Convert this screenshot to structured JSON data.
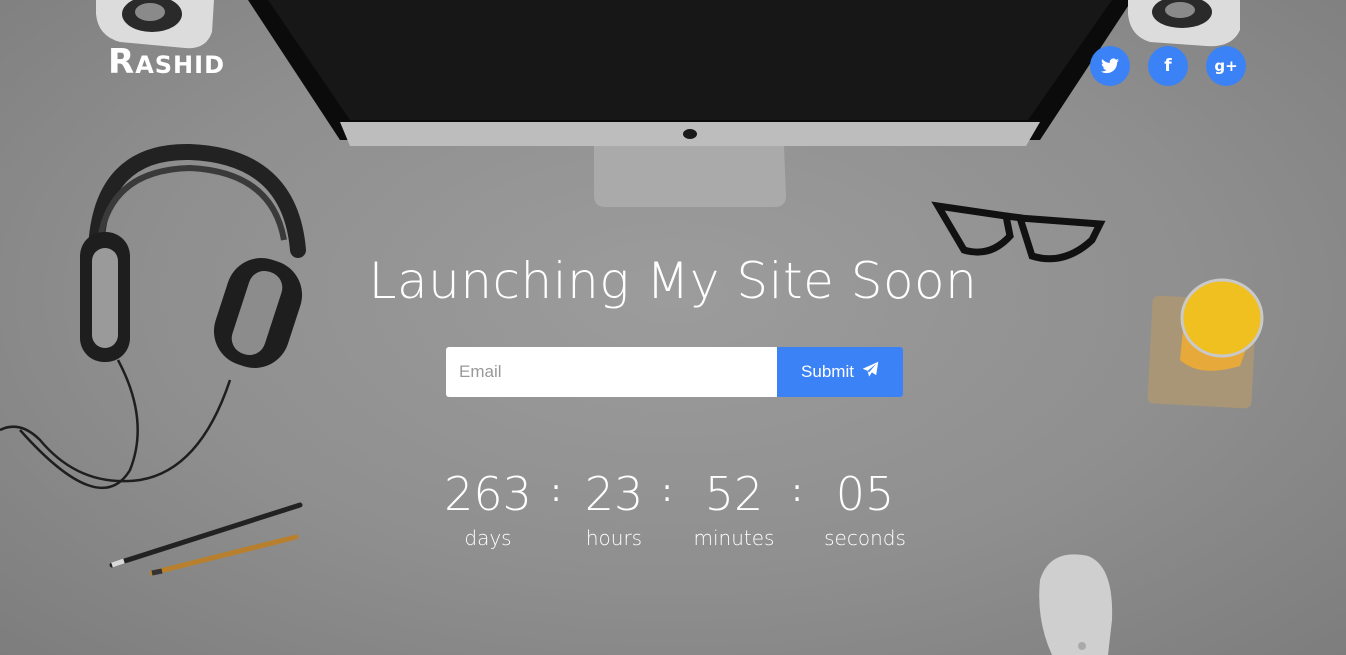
{
  "brand": {
    "logo_cap": "R",
    "logo_rest": "ashid"
  },
  "social": [
    {
      "name": "twitter",
      "icon": "twitter-icon"
    },
    {
      "name": "facebook",
      "icon": "facebook-icon",
      "glyph": "f"
    },
    {
      "name": "google-plus",
      "icon": "google-plus-icon",
      "glyph": "g+"
    }
  ],
  "hero": {
    "headline": "Launching My Site Soon"
  },
  "subscribe": {
    "email_placeholder": "Email",
    "submit_label": "Submit",
    "submit_icon": "paper-plane-icon"
  },
  "countdown": {
    "days": {
      "value": "263",
      "label": "days"
    },
    "hours": {
      "value": "23",
      "label": "hours"
    },
    "minutes": {
      "value": "52",
      "label": "minutes"
    },
    "seconds": {
      "value": "05",
      "label": "seconds"
    },
    "separator": ":"
  },
  "colors": {
    "accent": "#3b82f6",
    "text": "#ffffff",
    "background": "#8f8f8f"
  }
}
